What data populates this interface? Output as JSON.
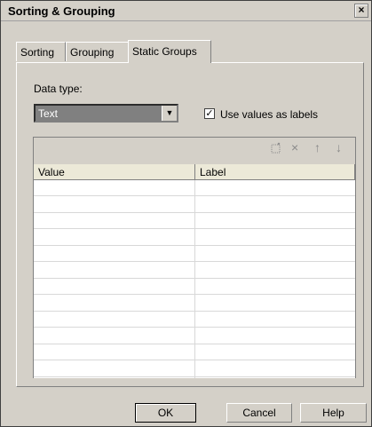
{
  "dialog": {
    "title": "Sorting & Grouping",
    "close_symbol": "×"
  },
  "tabs": [
    {
      "label": "Sorting"
    },
    {
      "label": "Grouping"
    },
    {
      "label": "Static Groups"
    }
  ],
  "static_groups": {
    "data_type_label": "Data type:",
    "data_type_value": "Text",
    "use_values_as_labels_label": "Use values as labels",
    "use_values_as_labels_checked": true
  },
  "toolbar": {
    "icons": [
      "new-row-icon",
      "delete-icon",
      "move-up-icon",
      "move-down-icon"
    ],
    "glyphs": {
      "delete": "×",
      "move_up": "↑",
      "move_down": "↓"
    }
  },
  "table": {
    "columns": [
      "Value",
      "Label"
    ],
    "rows": [
      [
        "",
        ""
      ],
      [
        "",
        ""
      ],
      [
        "",
        ""
      ],
      [
        "",
        ""
      ],
      [
        "",
        ""
      ],
      [
        "",
        ""
      ],
      [
        "",
        ""
      ],
      [
        "",
        ""
      ],
      [
        "",
        ""
      ],
      [
        "",
        ""
      ],
      [
        "",
        ""
      ],
      [
        "",
        ""
      ]
    ]
  },
  "buttons": {
    "ok": "OK",
    "cancel": "Cancel",
    "help": "Help"
  }
}
